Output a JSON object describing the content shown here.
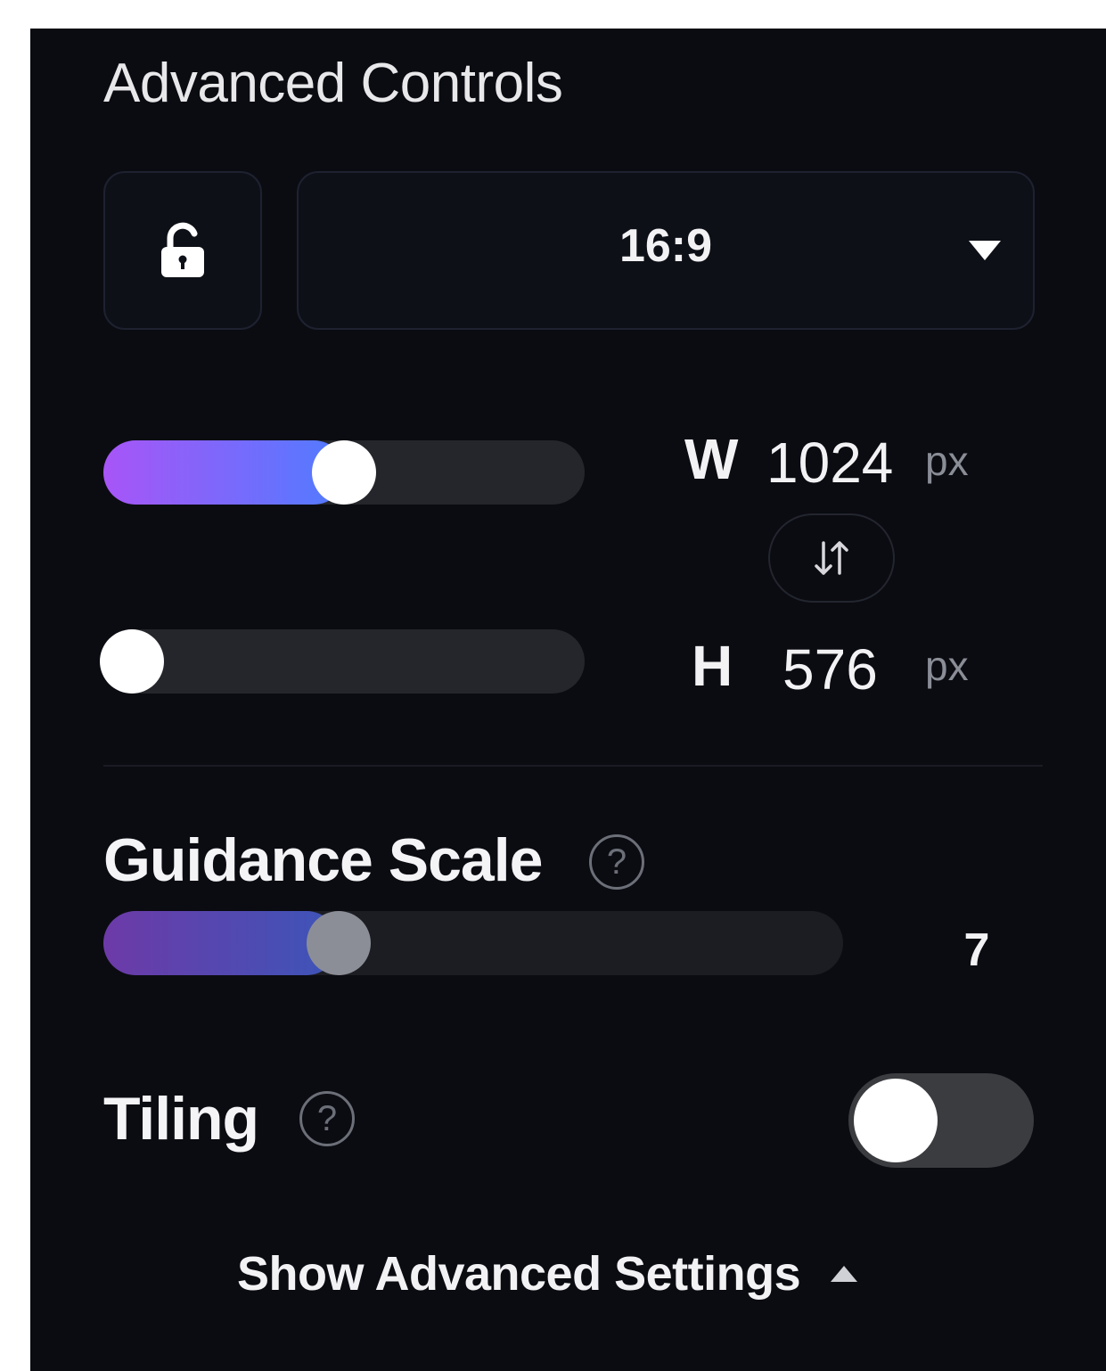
{
  "panel": {
    "title": "Advanced Controls"
  },
  "aspect": {
    "lock_icon": "unlocked-padlock-icon",
    "ratio_value": "16:9",
    "dropdown_icon": "caret-down-icon"
  },
  "dimensions": {
    "width": {
      "label": "W",
      "value": "1024",
      "unit": "px",
      "slider_level": 0.43
    },
    "swap_icon": "swap-vertical-arrows-icon",
    "height": {
      "label": "H",
      "value": "576",
      "unit": "px",
      "slider_level": 0.0
    }
  },
  "guidance": {
    "label": "Guidance Scale",
    "help_icon": "?",
    "value": "7",
    "slider_level": 0.23
  },
  "tiling": {
    "label": "Tiling",
    "help_icon": "?",
    "enabled": false
  },
  "footer": {
    "show_advanced_label": "Show Advanced Settings",
    "caret_icon": "caret-up-icon"
  },
  "colors": {
    "background": "#0b0c12",
    "slider_gradient_start": "#a855f7",
    "slider_gradient_end": "#4f7cff",
    "track": "#25262b"
  }
}
